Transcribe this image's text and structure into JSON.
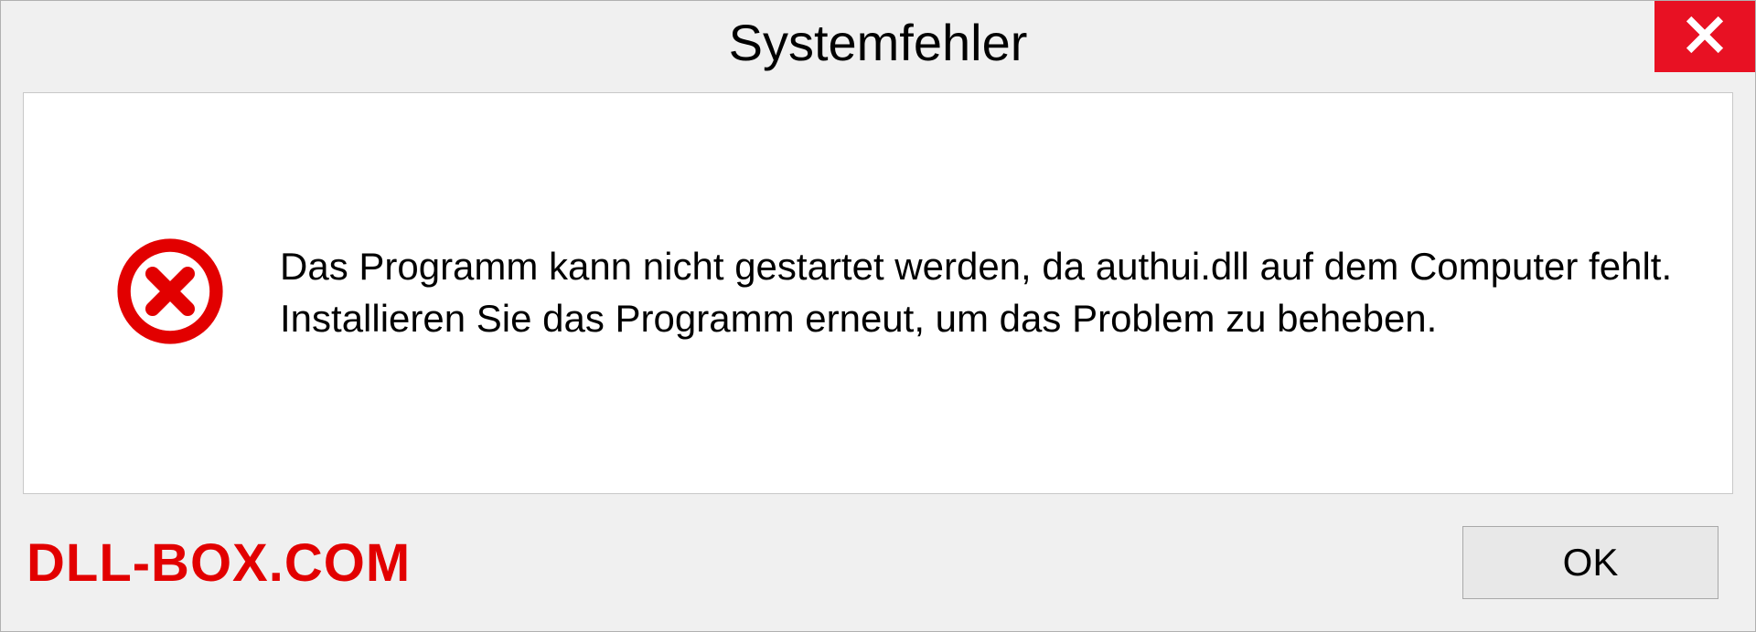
{
  "dialog": {
    "title": "Systemfehler",
    "message": "Das Programm kann nicht gestartet werden, da authui.dll auf dem Computer fehlt. Installieren Sie das Programm erneut, um das Problem zu beheben.",
    "ok_label": "OK"
  },
  "watermark": "DLL-BOX.COM"
}
